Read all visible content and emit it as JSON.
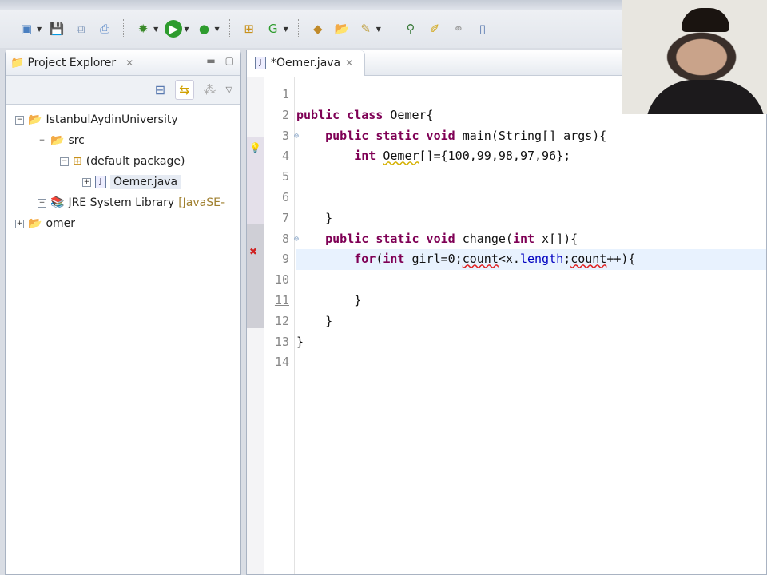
{
  "toolbar": {
    "icons": [
      "new-icon",
      "save-icon",
      "save-all-icon",
      "print-icon",
      "debug-icon",
      "run-icon",
      "external-tools-icon",
      "new-package-icon",
      "new-class-icon"
    ]
  },
  "project_explorer": {
    "title": "Project Explorer",
    "tree": [
      {
        "label": "IstanbulAydinUniversity",
        "level": 0,
        "expanded": true
      },
      {
        "label": "src",
        "level": 1,
        "expanded": true
      },
      {
        "label": "(default package)",
        "level": 2,
        "expanded": true
      },
      {
        "label": "Oemer.java",
        "level": 3,
        "expanded": false
      },
      {
        "label": "JRE System Library",
        "suffix": "[JavaSE-",
        "level": 1,
        "expanded": false
      },
      {
        "label": "omer",
        "level": 0,
        "expanded": false
      }
    ]
  },
  "editor": {
    "tab_label": "*Oemer.java",
    "line_numbers": [
      "1",
      "2",
      "3",
      "4",
      "5",
      "6",
      "7",
      "8",
      "9",
      "10",
      "11",
      "12",
      "13",
      "14"
    ],
    "lines": {
      "l2a": "public class",
      "l2b": " Oemer{",
      "l3a": "public static void",
      "l3b": " main(String[] args){",
      "l4a": "int",
      "l4b": "Oemer",
      "l4c": "[]={100,99,98,97,96};",
      "l7": "}",
      "l8a": "public static void",
      "l8b": " change(",
      "l8c": "int",
      "l8d": " x[]){",
      "l9a": "for",
      "l9b": "(",
      "l9c": "int",
      "l9d": " girl=0;",
      "l9e": "count",
      "l9f": "<x.",
      "l9g": "length",
      "l9h": ";",
      "l9i": "count",
      "l9j": "++){",
      "l11": "}",
      "l12": "}",
      "l13": "}"
    }
  }
}
